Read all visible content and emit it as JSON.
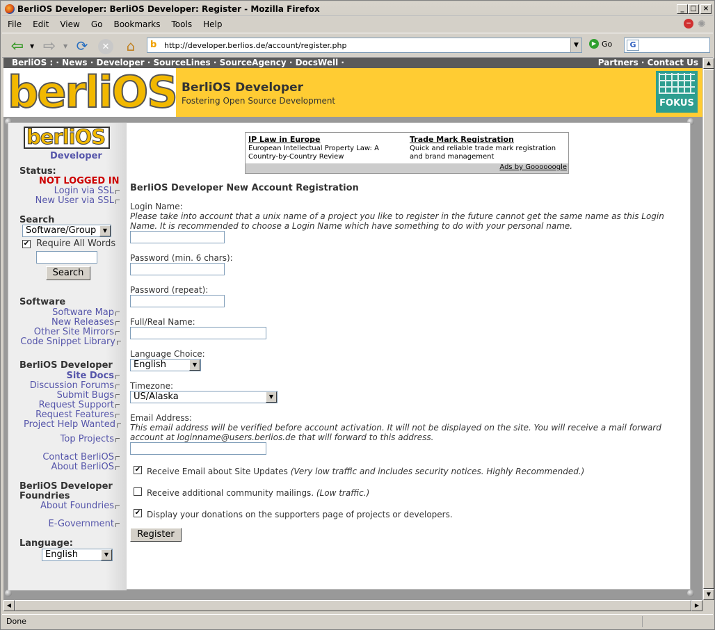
{
  "browser": {
    "title": "BerliOS Developer: BerliOS Developer: Register - Mozilla Firefox",
    "menu": [
      "File",
      "Edit",
      "View",
      "Go",
      "Bookmarks",
      "Tools",
      "Help"
    ],
    "url": "http://developer.berlios.de/account/register.php",
    "go_label": "Go",
    "status": "Done"
  },
  "topnav": {
    "left": "BerliOS :  · News · Developer · SourceLines · SourceAgency · DocsWell ·",
    "right": "Partners · Contact Us"
  },
  "banner": {
    "logo_text": "berliOS",
    "title": "BerliOS Developer",
    "subtitle": "Fostering Open Source Development",
    "fokus_label": "FOKUS"
  },
  "sidebar": {
    "logo_text": "berliOS",
    "developer_label": "Developer",
    "status_heading": "Status:",
    "status_value": "NOT LOGGED IN",
    "login_ssl": "Login via SSL",
    "new_user_ssl": "New User via SSL",
    "search_heading": "Search",
    "search_scope": "Software/Group",
    "require_all": "Require All Words",
    "search_button": "Search",
    "software_heading": "Software",
    "software_links": [
      "Software Map",
      "New Releases",
      "Other Site Mirrors",
      "Code Snippet Library"
    ],
    "developer_heading": "BerliOS Developer",
    "site_docs": "Site Docs",
    "developer_links": [
      "Discussion Forums",
      "Submit Bugs",
      "Request Support",
      "Request Features",
      "Project Help Wanted"
    ],
    "top_projects": "Top Projects",
    "contact_links": [
      "Contact BerliOS",
      "About BerliOS"
    ],
    "foundries_heading_1": "BerliOS Developer",
    "foundries_heading_2": "Foundries",
    "about_foundries": "About Foundries",
    "egov": "E-Government",
    "language_heading": "Language:",
    "language_value": "English"
  },
  "ads": {
    "ad1_title": "IP Law in Europe",
    "ad1_text": "European Intellectual Property Law: A Country-by-Country Review",
    "ad2_title": "Trade Mark Registration",
    "ad2_text": "Quick and reliable trade mark registration and brand management",
    "footer": "Ads by Goooooogle"
  },
  "form": {
    "title": "BerliOS Developer New Account Registration",
    "login_label": "Login Name:",
    "login_note_1": "Please take into account that a unix name of a project you like to register in the future cannot get the same name as this Login",
    "login_note_2": "Name. It is recommended to choose a Login Name which have something to do with your personal name.",
    "password_label": "Password (min. 6 chars):",
    "password_repeat_label": "Password (repeat):",
    "realname_label": "Full/Real Name:",
    "language_label": "Language Choice:",
    "language_value": "English",
    "timezone_label": "Timezone:",
    "timezone_value": "US/Alaska",
    "email_label": "Email Address:",
    "email_note_1": "This email address will be verified before account activation. It will not be displayed on the site. You will receive a mail forward",
    "email_note_2": "account at loginname@users.berlios.de that will forward to this address.",
    "opt1_text": "Receive Email about Site Updates",
    "opt1_note": "(Very low traffic and includes security notices. Highly Recommended.)",
    "opt2_text": "Receive additional community mailings.",
    "opt2_note": "(Low traffic.)",
    "opt3_text": "Display your donations on the supporters page of projects or developers.",
    "register_button": "Register"
  }
}
